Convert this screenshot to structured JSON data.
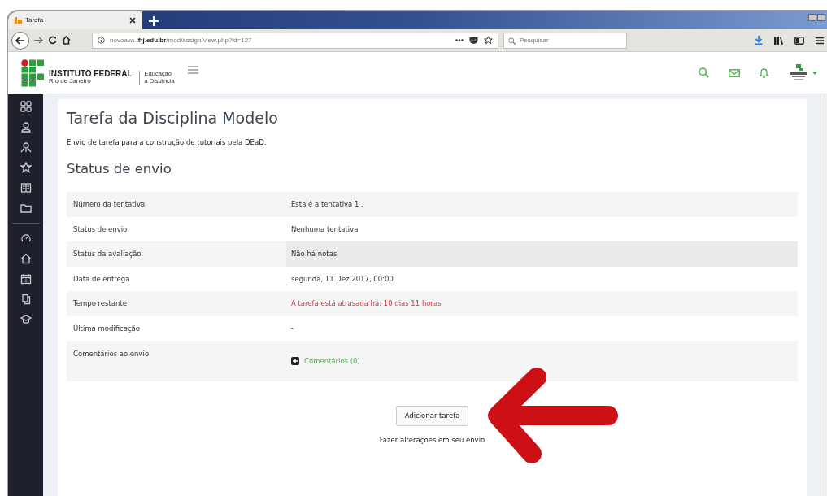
{
  "browser": {
    "tab_title": "Tarefa",
    "url": "novoava.**ifrj.edu.br**/mod/assign/view.php?id=127",
    "search_placeholder": "Pesquisar"
  },
  "site_header": {
    "brand": "INSTITUTO FEDERAL",
    "brand_sub": "Rio de Janeiro",
    "section_line1": "Educação",
    "section_line2": "a Distância"
  },
  "page": {
    "title": "Tarefa da Disciplina Modelo",
    "description": "Envio de tarefa para a construção de tutoriais pela DEaD.",
    "section_title": "Status de envio"
  },
  "status_table": [
    {
      "label": "Número da tentativa",
      "value": "Esta é a tentativa 1 .",
      "kind": "plain"
    },
    {
      "label": "Status de envio",
      "value": "Nenhuma tentativa",
      "kind": "plain"
    },
    {
      "label": "Status da avaliação",
      "value": "Não há notas",
      "kind": "grade"
    },
    {
      "label": "Data de entrega",
      "value": "segunda, 11 Dez 2017, 00:00",
      "kind": "plain"
    },
    {
      "label": "Tempo restante",
      "value": "A tarefa está atrasada há: 10 dias 11 horas",
      "kind": "overdue"
    },
    {
      "label": "Última modificação",
      "value": "-",
      "kind": "plain"
    },
    {
      "label": "Comentários ao envio",
      "value": "Comentários (0)",
      "kind": "comments"
    }
  ],
  "add_button": "Adicionar tarefa",
  "add_hint": "Fazer alterações em seu envio"
}
